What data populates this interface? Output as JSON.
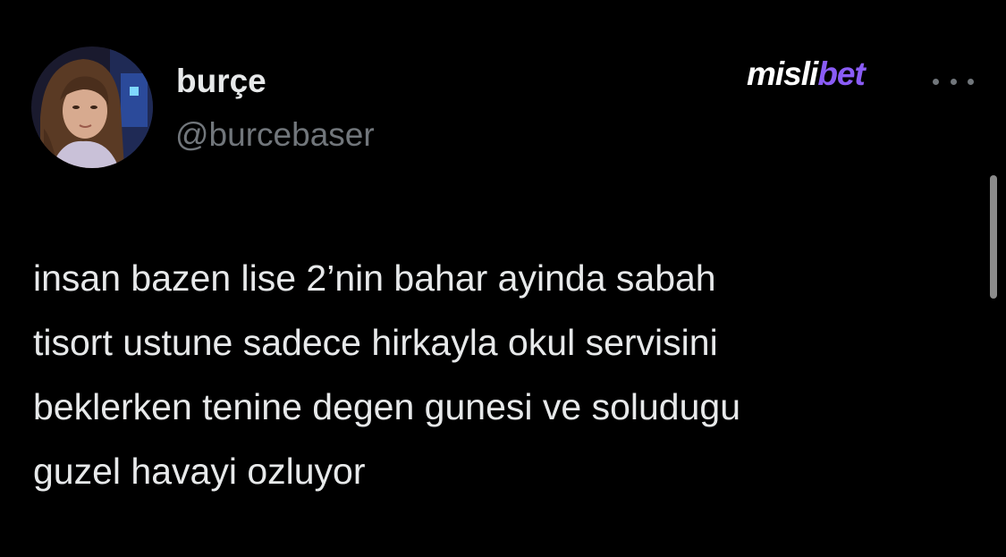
{
  "author": {
    "display_name": "burçe",
    "handle": "@burcebaser",
    "avatar_icon": "profile-photo"
  },
  "watermark": {
    "part1": "misli",
    "part2": "bet",
    "part1_color": "#ffffff",
    "part2_color": "#8a5cf6"
  },
  "more_icon": "ellipsis-icon",
  "tweet": {
    "lines": [
      "insan bazen lise 2’nin bahar ayinda sabah",
      "tisort ustune sadece hirkayla okul servisini",
      "beklerken tenine degen gunesi ve soludugu",
      "guzel havayi ozluyor"
    ]
  },
  "colors": {
    "background": "#000000",
    "text_primary": "#e7e9ea",
    "text_secondary": "#71767b"
  }
}
